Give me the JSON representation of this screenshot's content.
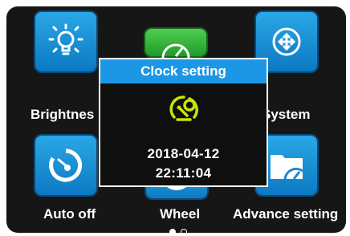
{
  "tiles": [
    {
      "label": "Brightnes",
      "icon": "bulb-icon"
    },
    {
      "label": "Clock setting",
      "icon": "gauge-wrench-icon"
    },
    {
      "label": "System",
      "icon": "system-arrows-icon"
    },
    {
      "label": "Auto off",
      "icon": "power-timer-icon"
    },
    {
      "label": "Wheel",
      "icon": "wheel-icon"
    },
    {
      "label": "Advance setting",
      "icon": "folder-gauge-icon"
    }
  ],
  "dialog": {
    "title": "Clock setting",
    "icon": "gauge-wrench-icon",
    "date": "2018-04-12",
    "time": "22:11:04"
  },
  "pagination": {
    "pages": 2,
    "current": 1
  },
  "colors": {
    "tile_blue": "#1892da",
    "tile_green": "#34b53a",
    "header_blue": "#1b97e6",
    "icon_yellow": "#c8e600",
    "background": "#161616"
  }
}
